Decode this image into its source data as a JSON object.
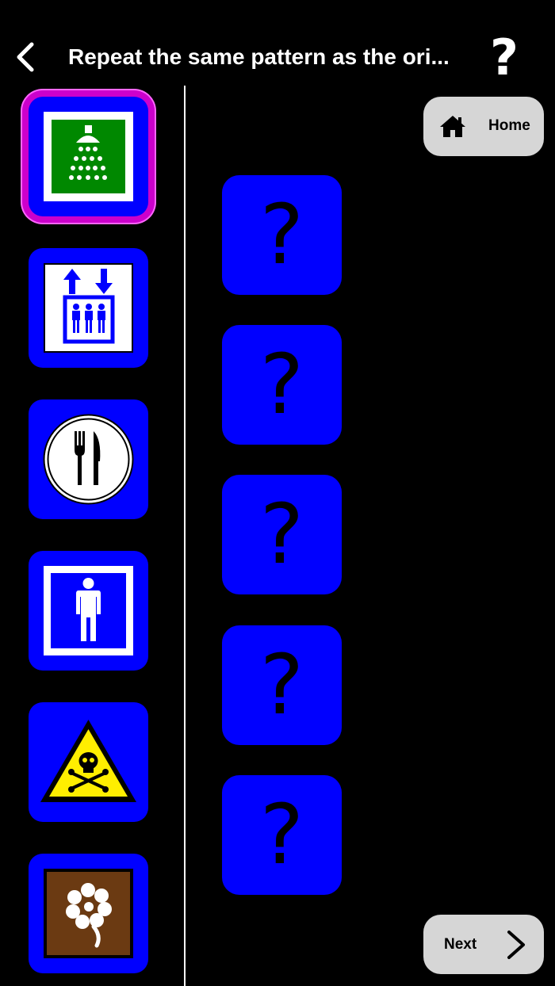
{
  "header": {
    "back_icon": "chevron-left-icon",
    "title": "Repeat the same pattern as the ori...",
    "help_label": "?"
  },
  "home_button": {
    "icon": "house-icon",
    "label": "Home"
  },
  "next_button": {
    "label": "Next",
    "icon": "chevron-right-icon"
  },
  "symbols": [
    {
      "name": "shower",
      "icon": "shower-icon",
      "selected": true
    },
    {
      "name": "elevator",
      "icon": "elevator-icon",
      "selected": false
    },
    {
      "name": "restaurant",
      "icon": "fork-knife-icon",
      "selected": false
    },
    {
      "name": "male",
      "icon": "person-icon",
      "selected": false
    },
    {
      "name": "toxic",
      "icon": "toxic-warning-icon",
      "selected": false
    },
    {
      "name": "flower",
      "icon": "flower-icon",
      "selected": false
    }
  ],
  "answer_slots": [
    {
      "label": "?"
    },
    {
      "label": "?"
    },
    {
      "label": "?"
    },
    {
      "label": "?"
    },
    {
      "label": "?"
    }
  ],
  "colors": {
    "background": "#000000",
    "tile_blue": "#0000ff",
    "selection_magenta": "#cc00cc",
    "button_gray": "#d6d6d6",
    "shower_green": "#008800",
    "flower_brown": "#6b3a12",
    "warning_yellow": "#ffee00"
  }
}
